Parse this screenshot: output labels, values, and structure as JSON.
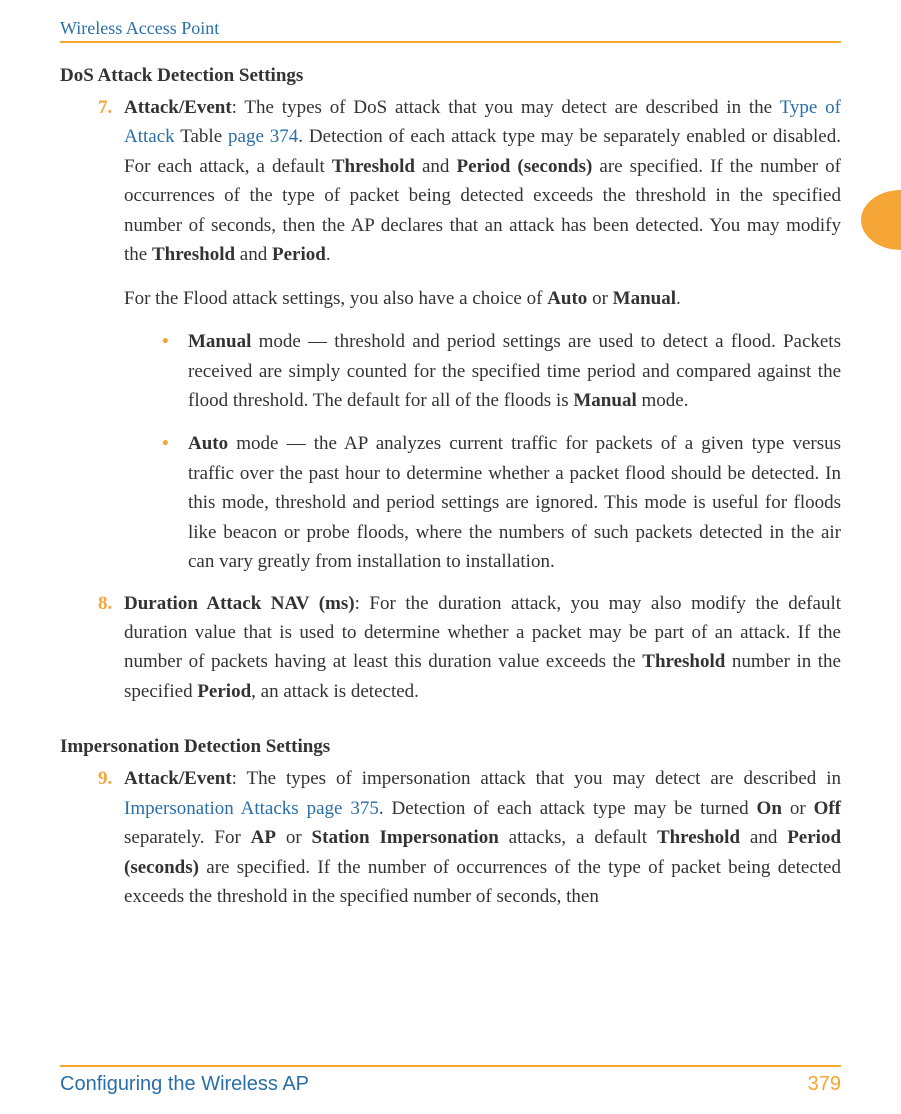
{
  "header": {
    "title": "Wireless Access Point"
  },
  "dos": {
    "title": "DoS Attack Detection Settings",
    "item7": {
      "num": "7.",
      "lead": "Attack/Event",
      "text1a": ": The types of DoS attack that you may detect are described in the ",
      "link1": "Type of Attack",
      "text1b": " Table ",
      "link2": "page 374",
      "text1c": ". Detection of each attack type may be separately enabled or disabled. For each attack, a default ",
      "bold1": "Threshold",
      "text1d": " and ",
      "bold2": "Period (seconds)",
      "text1e": " are specified. If the number of occurrences of the type of packet being detected exceeds the threshold in the specified number of seconds, then the AP declares that an attack has been detected. You may modify the ",
      "bold3": "Threshold",
      "text1f": " and ",
      "bold4": "Period",
      "text1g": ".",
      "para2a": "For the Flood attack settings, you also have a choice of ",
      "para2b": "Auto",
      "para2c": " or ",
      "para2d": "Manual",
      "para2e": "."
    },
    "bullet_manual": {
      "lead": "Manual",
      "text_a": " mode — threshold and period settings are used to detect a flood. Packets received are simply counted for the specified time period and compared against the flood threshold.  The default for all of the floods is ",
      "bold": "Manual",
      "text_b": " mode."
    },
    "bullet_auto": {
      "lead": "Auto",
      "text": " mode — the AP analyzes current traffic for packets of a given type versus traffic over the past hour to determine whether a packet flood should be detected.  In this mode, threshold and period settings are ignored. This mode is useful for floods like beacon or probe floods, where the numbers of such packets detected in the air can vary greatly from installation to installation."
    },
    "item8": {
      "num": "8.",
      "lead": "Duration Attack NAV (ms)",
      "text_a": ": For the duration attack, you may also modify the default duration value that is used to determine whether a packet may be part of an attack. If the number of packets having at least this duration value exceeds the ",
      "bold1": "Threshold",
      "text_b": " number in the specified ",
      "bold2": "Period",
      "text_c": ", an attack is detected."
    }
  },
  "imp": {
    "title": "Impersonation Detection Settings",
    "item9": {
      "num": "9.",
      "lead": "Attack/Event",
      "text_a": ": The types of impersonation attack that you may detect are described in ",
      "link": "Impersonation Attacks page 375",
      "text_b": ". Detection of each attack type may be turned ",
      "bold1": "On",
      "text_c": " or ",
      "bold2": "Off",
      "text_d": " separately. For ",
      "bold3": "AP",
      "text_e": " or ",
      "bold4": "Station Impersonation",
      "text_f": " attacks, a default ",
      "bold5": "Threshold",
      "text_g": " and ",
      "bold6": "Period (seconds)",
      "text_h": " are specified. If the number of occurrences of the type of packet being detected exceeds the threshold in the specified number of seconds, then"
    }
  },
  "footer": {
    "left": "Configuring the Wireless AP",
    "page": "379"
  }
}
